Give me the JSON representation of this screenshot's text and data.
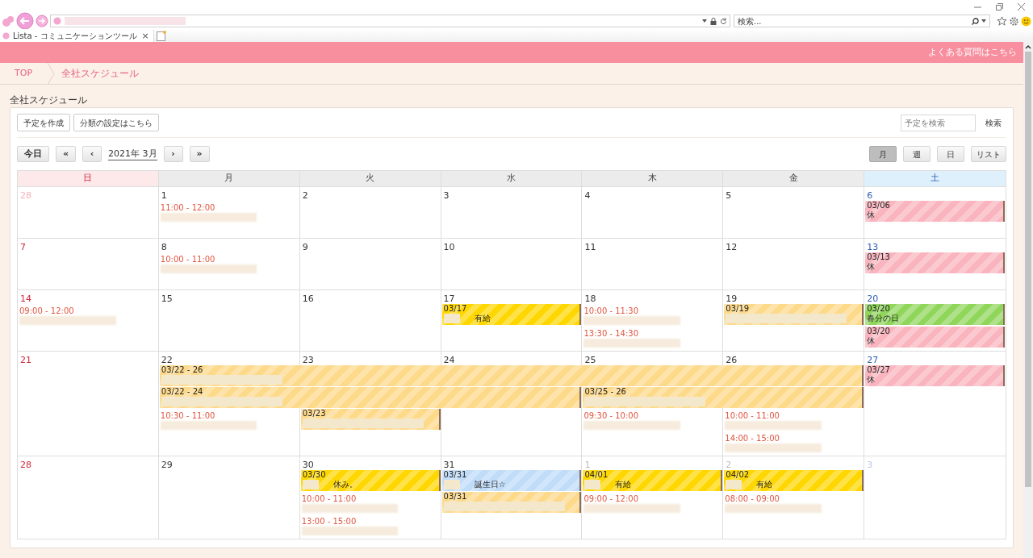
{
  "browser": {
    "search_placeholder": "検索...",
    "tab_title": "Lista - コミュニケーションツール",
    "tab_close": "×"
  },
  "header": {
    "faq_link": "よくある質問はこちら"
  },
  "breadcrumb": [
    "TOP",
    "全社スケジュール"
  ],
  "page_title": "全社スケジュール",
  "toolbar": {
    "buttons": [
      "予定を作成",
      "分類の設定はこちら"
    ],
    "search_placeholder": "予定を検索",
    "search_button": "検索"
  },
  "nav": {
    "today": "今日",
    "prev_year": "«",
    "prev": "‹",
    "month": "2021年 3月",
    "next": "›",
    "next_year": "»"
  },
  "views": [
    {
      "label": "月",
      "selected": true
    },
    {
      "label": "週",
      "selected": false
    },
    {
      "label": "日",
      "selected": false
    },
    {
      "label": "リスト",
      "selected": false
    }
  ],
  "weekdays": [
    {
      "label": "日",
      "kind": "sunday"
    },
    {
      "label": "月",
      "kind": "weekday"
    },
    {
      "label": "火",
      "kind": "weekday"
    },
    {
      "label": "水",
      "kind": "weekday"
    },
    {
      "label": "木",
      "kind": "weekday"
    },
    {
      "label": "金",
      "kind": "weekday"
    },
    {
      "label": "土",
      "kind": "saturday"
    }
  ],
  "weeks": [
    {
      "days": [
        {
          "date": "28",
          "outside": true
        },
        {
          "date": "1",
          "outside": false,
          "events": [
            {
              "kind": "timed",
              "time": "11:00 - 12:00"
            }
          ]
        },
        {
          "date": "2",
          "outside": false
        },
        {
          "date": "3",
          "outside": false
        },
        {
          "date": "4",
          "outside": false
        },
        {
          "date": "5",
          "outside": false
        },
        {
          "date": "6",
          "outside": false,
          "events": [
            {
              "kind": "allday",
              "label": "03/06",
              "title": "休",
              "color": "#f9b4be",
              "redacted": false
            }
          ]
        }
      ]
    },
    {
      "days": [
        {
          "date": "7",
          "outside": false
        },
        {
          "date": "8",
          "outside": false,
          "events": [
            {
              "kind": "timed",
              "time": "10:00 - 11:00"
            }
          ]
        },
        {
          "date": "9",
          "outside": false
        },
        {
          "date": "10",
          "outside": false
        },
        {
          "date": "11",
          "outside": false
        },
        {
          "date": "12",
          "outside": false
        },
        {
          "date": "13",
          "outside": false,
          "events": [
            {
              "kind": "allday",
              "label": "03/13",
              "title": "休",
              "color": "#f9b4be",
              "redacted": false
            }
          ]
        }
      ]
    },
    {
      "days": [
        {
          "date": "14",
          "outside": false,
          "events": [
            {
              "kind": "timed",
              "time": "09:00 - 12:00"
            }
          ]
        },
        {
          "date": "15",
          "outside": false
        },
        {
          "date": "16",
          "outside": false
        },
        {
          "date": "17",
          "outside": false,
          "events": [
            {
              "kind": "allday",
              "label": "03/17",
              "title": "有給",
              "color": "#ffd700",
              "redacted": true
            }
          ]
        },
        {
          "date": "18",
          "outside": false,
          "events": [
            {
              "kind": "timed",
              "time": "10:00 - 11:30"
            },
            {
              "kind": "timed",
              "time": "13:30 - 14:30"
            }
          ]
        },
        {
          "date": "19",
          "outside": false,
          "events": [
            {
              "kind": "allday",
              "label": "03/19",
              "color": "#fdd98a",
              "redacted": true
            }
          ]
        },
        {
          "date": "20",
          "outside": false,
          "events": [
            {
              "kind": "allday",
              "label": "03/20",
              "title": "春分の日",
              "color": "#8fd65b",
              "redacted": false
            },
            {
              "kind": "allday",
              "label": "03/20",
              "title": "休",
              "color": "#f9b4be",
              "redacted": false
            }
          ]
        }
      ]
    },
    {
      "days": [
        {
          "date": "21",
          "outside": false
        },
        {
          "date": "22",
          "outside": false,
          "events": [
            {
              "kind": "allday",
              "label": "03/22 - 26",
              "color": "#fdd98a",
              "redacted": true
            },
            {
              "kind": "allday",
              "label": "03/22 - 24",
              "color": "#fdd98a",
              "redacted": true
            },
            {
              "kind": "timed",
              "time": "10:30 - 11:00"
            }
          ]
        },
        {
          "date": "23",
          "outside": false,
          "events": [
            {
              "kind": "continued"
            },
            {
              "kind": "continued"
            },
            {
              "kind": "allday",
              "label": "03/23",
              "color": "#fdd98a",
              "redacted": true
            }
          ]
        },
        {
          "date": "24",
          "outside": false,
          "events": [
            {
              "kind": "continued"
            },
            {
              "kind": "continued"
            }
          ]
        },
        {
          "date": "25",
          "outside": false,
          "events": [
            {
              "kind": "continued"
            },
            {
              "kind": "allday",
              "label": "03/25 - 26",
              "color": "#fdd98a",
              "redacted": true
            },
            {
              "kind": "timed",
              "time": "09:30 - 10:00"
            }
          ]
        },
        {
          "date": "26",
          "outside": false,
          "events": [
            {
              "kind": "continued"
            },
            {
              "kind": "continued"
            },
            {
              "kind": "timed",
              "time": "10:00 - 11:00"
            },
            {
              "kind": "timed",
              "time": "14:00 - 15:00"
            }
          ]
        },
        {
          "date": "27",
          "outside": false,
          "events": [
            {
              "kind": "allday",
              "label": "03/27",
              "title": "休",
              "color": "#f9b4be",
              "redacted": false
            }
          ]
        }
      ]
    },
    {
      "days": [
        {
          "date": "28",
          "outside": false
        },
        {
          "date": "29",
          "outside": false
        },
        {
          "date": "30",
          "outside": false,
          "events": [
            {
              "kind": "allday",
              "label": "03/30",
              "title": "休み。",
              "color": "#ffd700",
              "redacted": true
            },
            {
              "kind": "timed",
              "time": "10:00 - 11:00"
            },
            {
              "kind": "timed",
              "time": "13:00 - 15:00"
            }
          ]
        },
        {
          "date": "31",
          "outside": false,
          "events": [
            {
              "kind": "allday",
              "label": "03/31",
              "title": "誕生日☆",
              "color": "#bfdcf8",
              "redacted": true
            },
            {
              "kind": "allday",
              "label": "03/31",
              "color": "#fdd98a",
              "redacted": true
            }
          ]
        },
        {
          "date": "1",
          "outside": true,
          "events": [
            {
              "kind": "allday",
              "label": "04/01",
              "title": "有給",
              "color": "#ffd700",
              "redacted": true
            },
            {
              "kind": "timed",
              "time": "09:00 - 12:00"
            }
          ]
        },
        {
          "date": "2",
          "outside": true,
          "events": [
            {
              "kind": "allday",
              "label": "04/02",
              "title": "有給",
              "color": "#ffd700",
              "redacted": true
            },
            {
              "kind": "timed",
              "time": "08:00 - 09:00"
            }
          ]
        },
        {
          "date": "3",
          "outside": true
        }
      ]
    }
  ]
}
